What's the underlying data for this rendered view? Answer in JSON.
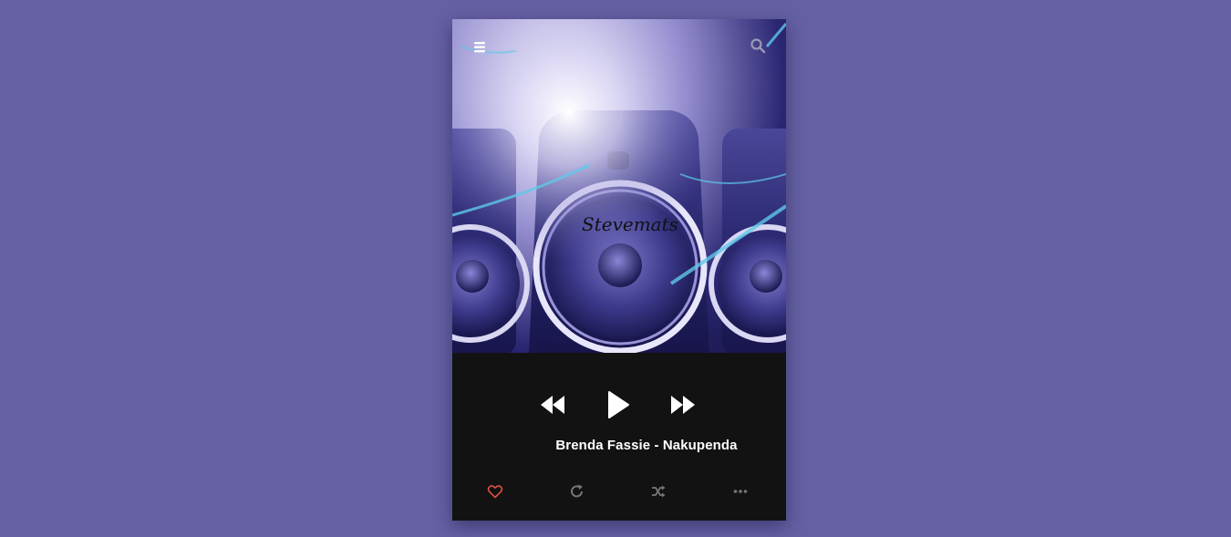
{
  "header": {
    "menu_icon": "menu-icon",
    "search_icon": "search-icon"
  },
  "cover": {
    "logo_text": "Stevemats"
  },
  "controls": {
    "prev_icon": "rewind-icon",
    "play_icon": "play-icon",
    "next_icon": "fast-forward-icon"
  },
  "track": {
    "title": "Brenda Fassie - Nakupenda"
  },
  "actions": {
    "like_icon": "heart-icon",
    "repeat_icon": "repeat-icon",
    "shuffle_icon": "shuffle-icon",
    "more_icon": "more-icon"
  },
  "colors": {
    "background": "#6460a3",
    "panel": "#121212",
    "like_active": "#e0503f",
    "icon_muted": "#777777",
    "text": "#ffffff"
  }
}
